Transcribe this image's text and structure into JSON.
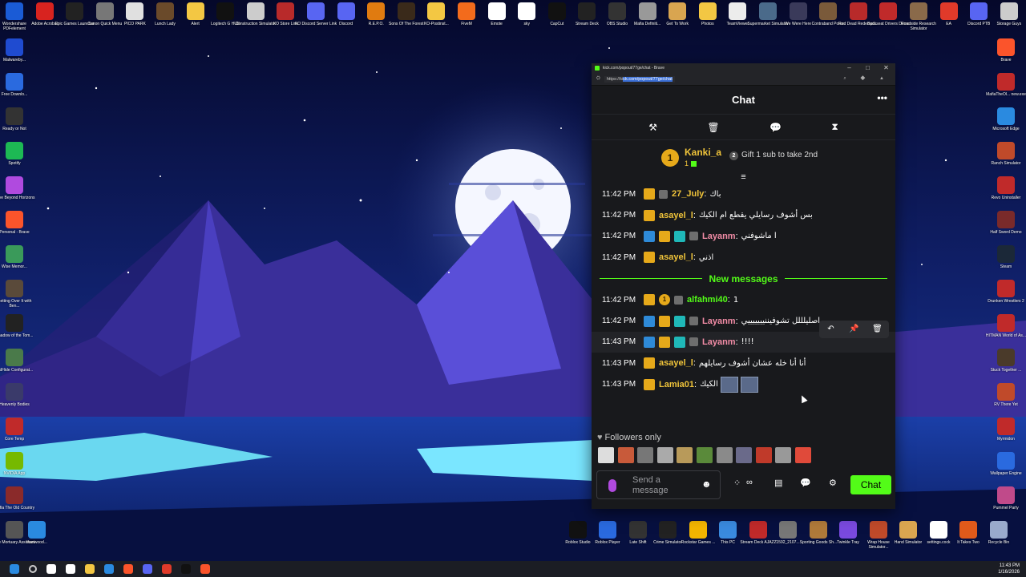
{
  "desktop": {
    "top_icons": [
      {
        "label": "Wondershare PDFelement",
        "color": "#1a5bd6"
      },
      {
        "label": "Adobe Acrobat",
        "color": "#d8231f"
      },
      {
        "label": "Epic Games Launcher",
        "color": "#222"
      },
      {
        "label": "Canon Quick Menu",
        "color": "#777"
      },
      {
        "label": "PICO PARK",
        "color": "#e0e0e0"
      },
      {
        "label": "Lunch Lady",
        "color": "#6a4a2a"
      },
      {
        "label": "Alert",
        "color": "#f3c743"
      },
      {
        "label": "Logitech G HUB",
        "color": "#111"
      },
      {
        "label": "Construction Simulator",
        "color": "#ccc"
      },
      {
        "label": "KO Store Link",
        "color": "#b82a2a"
      },
      {
        "label": "KO Discord Server Link",
        "color": "#5865f2"
      },
      {
        "label": "Discord",
        "color": "#5865f2"
      },
      {
        "label": "R.E.P.O.",
        "color": "#e07b10"
      },
      {
        "label": "Sons Of The Forest",
        "color": "#3a2a1a"
      },
      {
        "label": "KO-Postinst...",
        "color": "#f3c743"
      },
      {
        "label": "FiveM",
        "color": "#f36b1c"
      },
      {
        "label": "Emote",
        "color": "#fff"
      },
      {
        "label": "sky",
        "color": "#fff"
      },
      {
        "label": "CapCut",
        "color": "#111"
      },
      {
        "label": "Stream Deck",
        "color": "#222"
      },
      {
        "label": "OBS Studio",
        "color": "#333"
      },
      {
        "label": "Mafia Definiti...",
        "color": "#999"
      },
      {
        "label": "Get To Work",
        "color": "#d9a550"
      },
      {
        "label": "Photos",
        "color": "#f3c743"
      },
      {
        "label": "TeamViewer",
        "color": "#ececec"
      },
      {
        "label": "Supermarket Simulator",
        "color": "#4a6a8a"
      },
      {
        "label": "We Were Here",
        "color": "#3a3a5a"
      },
      {
        "label": "Contraband Police",
        "color": "#7a5a3a"
      },
      {
        "label": "Red Dead Redempti...",
        "color": "#b82a2a"
      },
      {
        "label": "Backseat Drivers Demo",
        "color": "#c02a2a"
      },
      {
        "label": "Roadside Research Simulator",
        "color": "#8a6a4a"
      },
      {
        "label": "EA",
        "color": "#e03a2a"
      },
      {
        "label": "Discord PTB",
        "color": "#5865f2"
      },
      {
        "label": "Storage Guys",
        "color": "#ccc"
      }
    ],
    "left_icons": [
      {
        "label": "Malwareby...",
        "color": "#1f4bd0"
      },
      {
        "label": "Free Downlo...",
        "color": "#2a6adf"
      },
      {
        "label": "Ready or Not",
        "color": "#333"
      },
      {
        "label": "Spotify",
        "color": "#1db954"
      },
      {
        "label": "Drive Beyond Horizons",
        "color": "#b04adf"
      },
      {
        "label": "Personal - Brave",
        "color": "#fb542b"
      },
      {
        "label": "Wise Memor...",
        "color": "#3a9a5a"
      },
      {
        "label": "Getting Over It with Ben...",
        "color": "#5a4a3a"
      },
      {
        "label": "Shadow of the Tom...",
        "color": "#222"
      },
      {
        "label": "HidHide Configurat...",
        "color": "#4a7a4a"
      },
      {
        "label": "Heavenly Bodies",
        "color": "#3a3a6a"
      },
      {
        "label": "Core Temp",
        "color": "#c02a2a"
      },
      {
        "label": "NVIDIA App",
        "color": "#76b900"
      },
      {
        "label": "Mafia The Old Country",
        "color": "#8a2a2a"
      }
    ],
    "right_icons": [
      {
        "label": "Brave",
        "color": "#fb542b"
      },
      {
        "label": "MafiaTheOl... new.exe",
        "color": "#c02a2a"
      },
      {
        "label": "Microsoft Edge",
        "color": "#2a8ae0"
      },
      {
        "label": "Ranch Simulator",
        "color": "#c04a2a"
      },
      {
        "label": "Revo Uninstaller",
        "color": "#c02a2a"
      },
      {
        "label": "Half Sword Demo",
        "color": "#7a2a2a"
      },
      {
        "label": "Steam",
        "color": "#1b2838"
      },
      {
        "label": "Drunken Wrestlers 2",
        "color": "#c02a2a"
      },
      {
        "label": "HITMAN World of As...",
        "color": "#c02a2a"
      },
      {
        "label": "Stuck Together ...",
        "color": "#4a3a2a"
      },
      {
        "label": "RV There Yet",
        "color": "#c04a2a"
      },
      {
        "label": "Myrmidon",
        "color": "#c02a2a"
      },
      {
        "label": "Wallpaper Engine",
        "color": "#2a6adf"
      },
      {
        "label": "Pummel Party",
        "color": "#c04a8a"
      }
    ],
    "bottom_icons": [
      {
        "label": "The Mortuary Assistant",
        "color": "#555"
      },
      {
        "label": "thanwood...",
        "color": "#2a8ae0"
      },
      {
        "label": "Roblox Studio",
        "color": "#111"
      },
      {
        "label": "Roblox Player",
        "color": "#2a6adf"
      },
      {
        "label": "Late Shift",
        "color": "#333"
      },
      {
        "label": "Crime Simulator",
        "color": "#222"
      },
      {
        "label": "Rockstar Games ...",
        "color": "#f3b500"
      },
      {
        "label": "This PC",
        "color": "#3a8adf"
      },
      {
        "label": "Stream Deck AJAZZ",
        "color": "#c02a2a"
      },
      {
        "label": "1592_2107...",
        "color": "#777"
      },
      {
        "label": "Sporting Goods Sh...",
        "color": "#b07a3a"
      },
      {
        "label": "Twinkle Tray",
        "color": "#7a4adf"
      },
      {
        "label": "Wrap House Simulator...",
        "color": "#c04a2a"
      },
      {
        "label": "Hand Simulator",
        "color": "#d9a550"
      },
      {
        "label": "settings.cock",
        "color": "#fff"
      },
      {
        "label": "It Takes Two",
        "color": "#e05a1a"
      },
      {
        "label": "Recycle Bin",
        "color": "#9ac"
      }
    ]
  },
  "taskbar": {
    "time": "11:43 PM",
    "date": "1/16/2026",
    "apps": [
      "#fff",
      "#fff",
      "#f3c743",
      "#2a8ae0",
      "#fb542b",
      "#5865f2",
      "#e03a2a",
      "#111",
      "#fb542b"
    ]
  },
  "browser": {
    "title": "kick.com/popout/77ge/chat - Brave",
    "url_prefix": "https://ki",
    "url_selected": "ck.com/popout/77ge/chat",
    "url_icons": "⌕ ◆ ▲",
    "controls": {
      "minimize": "–",
      "maximize": "□",
      "close": "✕"
    }
  },
  "chat": {
    "title": "Chat",
    "menu": "•••",
    "mod_tools": [
      "⚒",
      "🗑",
      "💬",
      "⧗"
    ],
    "leaderboard": {
      "rank": "1",
      "username": "Kanki_a",
      "count": "1",
      "gift_rank": "2",
      "gift_label": "Gift 1 sub to take 2nd"
    },
    "collapse": "≡",
    "messages": [
      {
        "time": "11:42 PM",
        "badges": [
          "crown",
          "sub"
        ],
        "user": "27_July",
        "color": "#f0c43a",
        "text": "باك"
      },
      {
        "time": "11:42 PM",
        "badges": [
          "crown"
        ],
        "user": "asayel_l",
        "color": "#f0c43a",
        "text": "بس أشوف رسايلي يقطع ام الكيك"
      },
      {
        "time": "11:42 PM",
        "badges": [
          "mod",
          "crown",
          "og",
          "sub"
        ],
        "user": "Layanm",
        "color": "#f28ca6",
        "text": "ا ماشوفني"
      },
      {
        "time": "11:42 PM",
        "badges": [
          "crown"
        ],
        "user": "asayel_l",
        "color": "#f0c43a",
        "text": "اذني"
      }
    ],
    "new_messages_label": "New messages",
    "new_messages": [
      {
        "time": "11:42 PM",
        "badges": [
          "crown",
          "gift1",
          "sub"
        ],
        "user": "alfahmi40",
        "color": "#53fc18",
        "text": "1",
        "gift_num": "1"
      },
      {
        "time": "11:42 PM",
        "badges": [
          "mod",
          "crown",
          "og",
          "sub"
        ],
        "user": "Layanm",
        "color": "#f28ca6",
        "text": "اصليلللل تشوفيننيييييييي"
      },
      {
        "time": "11:43 PM",
        "badges": [
          "mod",
          "crown",
          "og",
          "sub"
        ],
        "user": "Layanm",
        "color": "#f28ca6",
        "text": "!!!!",
        "highlight": true
      },
      {
        "time": "11:43 PM",
        "badges": [
          "crown"
        ],
        "user": "asayel_l",
        "color": "#f0c43a",
        "text": "أنا أنا خله عشان أشوف رسايلهم"
      },
      {
        "time": "11:43 PM",
        "badges": [
          "crown"
        ],
        "user": "Lamia01",
        "color": "#f0c43a",
        "text": "الكيك",
        "emotes": 2
      }
    ],
    "hover_actions": [
      "↶",
      "📌",
      "🗑"
    ],
    "followers_label": "Followers only",
    "followers_icon": "♥",
    "emote_colors": [
      "#ddd",
      "#c85a3a",
      "#777",
      "#aaa",
      "#b89a5a",
      "#5a8a3a",
      "#8a8a8a",
      "#6a6a8a",
      "#c03a2a",
      "#999",
      "#e04a3a"
    ],
    "input_placeholder": "Send a message",
    "emoji_icon": "☻",
    "tools": [
      "⁘",
      "∞",
      "▤",
      "💬",
      "⚙"
    ],
    "send_button": "Chat"
  }
}
